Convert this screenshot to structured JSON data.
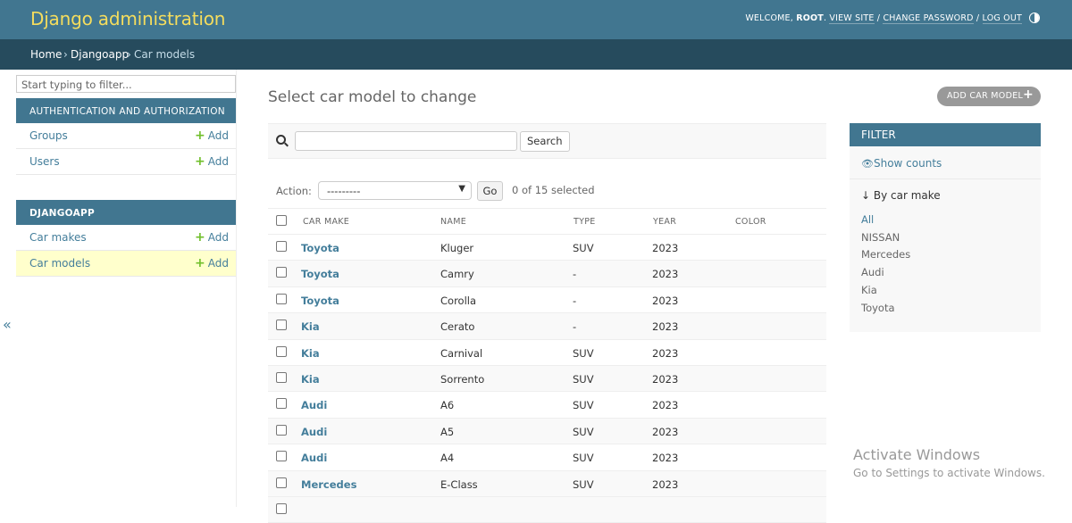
{
  "header": {
    "site_title": "Django administration",
    "welcome": "WELCOME,",
    "username": "ROOT",
    "view_site": "VIEW SITE",
    "change_password": "CHANGE PASSWORD",
    "log_out": "LOG OUT",
    "separator": "/"
  },
  "breadcrumbs": {
    "home": "Home",
    "app": "Djangoapp",
    "current": "Car models",
    "sep": "›"
  },
  "sidebar": {
    "filter_placeholder": "Start typing to filter...",
    "toggle": "«",
    "modules": [
      {
        "caption": "AUTHENTICATION AND AUTHORIZATION",
        "items": [
          {
            "label": "Groups",
            "add": "Add"
          },
          {
            "label": "Users",
            "add": "Add"
          }
        ]
      },
      {
        "caption": "DJANGOAPP",
        "items": [
          {
            "label": "Car makes",
            "add": "Add"
          },
          {
            "label": "Car models",
            "add": "Add"
          }
        ]
      }
    ]
  },
  "main": {
    "title": "Select car model to change",
    "add_button": "ADD CAR MODEL",
    "search_button": "Search",
    "action_label": "Action:",
    "action_value": "---------",
    "go_button": "Go",
    "selected_count": "0 of 15 selected",
    "columns": [
      "CAR MAKE",
      "NAME",
      "TYPE",
      "YEAR",
      "COLOR"
    ],
    "rows": [
      {
        "make": "Toyota",
        "name": "Kluger",
        "type": "SUV",
        "year": "2023",
        "color": ""
      },
      {
        "make": "Toyota",
        "name": "Camry",
        "type": "-",
        "year": "2023",
        "color": ""
      },
      {
        "make": "Toyota",
        "name": "Corolla",
        "type": "-",
        "year": "2023",
        "color": ""
      },
      {
        "make": "Kia",
        "name": "Cerato",
        "type": "-",
        "year": "2023",
        "color": ""
      },
      {
        "make": "Kia",
        "name": "Carnival",
        "type": "SUV",
        "year": "2023",
        "color": ""
      },
      {
        "make": "Kia",
        "name": "Sorrento",
        "type": "SUV",
        "year": "2023",
        "color": ""
      },
      {
        "make": "Audi",
        "name": "A6",
        "type": "SUV",
        "year": "2023",
        "color": ""
      },
      {
        "make": "Audi",
        "name": "A5",
        "type": "SUV",
        "year": "2023",
        "color": ""
      },
      {
        "make": "Audi",
        "name": "A4",
        "type": "SUV",
        "year": "2023",
        "color": ""
      },
      {
        "make": "Mercedes",
        "name": "E-Class",
        "type": "SUV",
        "year": "2023",
        "color": ""
      }
    ]
  },
  "filter": {
    "title": "FILTER",
    "show_counts": "Show counts",
    "by_label": "↓ By car make",
    "options": [
      "All",
      "NISSAN",
      "Mercedes",
      "Audi",
      "Kia",
      "Toyota"
    ],
    "selected": "All"
  },
  "watermark": {
    "title": "Activate Windows",
    "subtitle": "Go to Settings to activate Windows."
  }
}
